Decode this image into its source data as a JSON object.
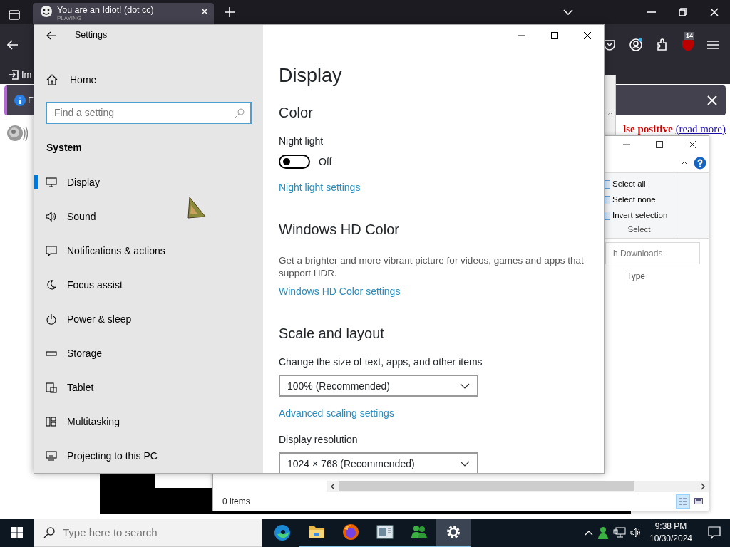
{
  "browser": {
    "tab": {
      "title": "You are an Idiot! (dot cc)",
      "subtitle": "PLAYING"
    },
    "toolbar": {
      "badge": "14"
    },
    "bookmarks": {
      "text": "Im"
    },
    "notification": {
      "text": "F"
    },
    "page": {
      "warning": "lse positive",
      "link": "(read more)"
    }
  },
  "explorer": {
    "ribbon": {
      "items": [
        "Select all",
        "Select none",
        "Invert selection"
      ],
      "group": "Select"
    },
    "search": {
      "placeholder": "h Downloads"
    },
    "columns": [
      "Type"
    ],
    "status": "0 items",
    "views": [
      {
        "selected": true
      },
      {
        "selected": false
      }
    ]
  },
  "settings": {
    "title": "Settings",
    "home": "Home",
    "search": {
      "placeholder": "Find a setting"
    },
    "section": "System",
    "nav": [
      {
        "label": "Display",
        "selected": true
      },
      {
        "label": "Sound",
        "selected": false
      },
      {
        "label": "Notifications & actions",
        "selected": false
      },
      {
        "label": "Focus assist",
        "selected": false
      },
      {
        "label": "Power & sleep",
        "selected": false
      },
      {
        "label": "Storage",
        "selected": false
      },
      {
        "label": "Tablet",
        "selected": false
      },
      {
        "label": "Multitasking",
        "selected": false
      },
      {
        "label": "Projecting to this PC",
        "selected": false
      }
    ],
    "content": [
      {
        "kind": "title",
        "text": "Display"
      },
      {
        "kind": "heading",
        "text": "Color"
      },
      {
        "kind": "label",
        "text": "Night light"
      },
      {
        "kind": "toggle",
        "on": false,
        "text": "Off"
      },
      {
        "kind": "link",
        "text": "Night light settings"
      },
      {
        "kind": "heading",
        "text": "Windows HD Color"
      },
      {
        "kind": "text",
        "text": "Get a brighter and more vibrant picture for videos, games and apps that support HDR."
      },
      {
        "kind": "link",
        "text": "Windows HD Color settings"
      },
      {
        "kind": "heading",
        "text": "Scale and layout"
      },
      {
        "kind": "label",
        "text": "Change the size of text, apps, and other items"
      },
      {
        "kind": "dropdown",
        "text": "100% (Recommended)"
      },
      {
        "kind": "link",
        "text": "Advanced scaling settings"
      },
      {
        "kind": "label",
        "text": "Display resolution"
      },
      {
        "kind": "dropdown",
        "text": "1024 × 768 (Recommended)"
      }
    ]
  },
  "taskbar": {
    "search": {
      "placeholder": "Type here to search"
    },
    "apps": [
      {
        "running": false,
        "selected": false
      },
      {
        "running": true,
        "selected": false
      },
      {
        "running": true,
        "selected": false
      },
      {
        "running": true,
        "selected": false
      },
      {
        "running": true,
        "selected": false
      },
      {
        "running": true,
        "selected": true
      }
    ],
    "time": "9:38 PM",
    "date": "10/30/2024"
  }
}
